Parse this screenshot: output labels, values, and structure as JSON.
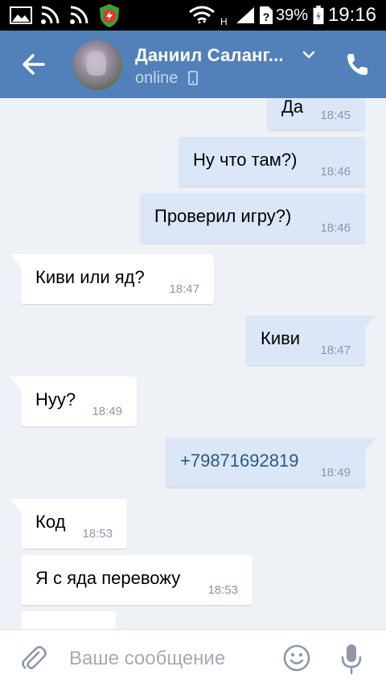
{
  "status_bar": {
    "network_indicator": "H",
    "battery_percent": "39%",
    "time": "19:16",
    "icons": [
      "image-icon",
      "rss-icon",
      "wifi-icon",
      "shield-app-icon",
      "wifi-signal-icon",
      "cell-signal-icon",
      "unknown-sim-icon",
      "battery-charging-icon"
    ]
  },
  "header": {
    "contact_name": "Даниил Саланг...",
    "status": "online"
  },
  "messages": [
    {
      "direction": "out",
      "text": "Да",
      "time": "18:45"
    },
    {
      "direction": "out",
      "text": "Ну что там?)",
      "time": "18:46"
    },
    {
      "direction": "out",
      "text": "Проверил игру?)",
      "time": "18:46"
    },
    {
      "direction": "in",
      "text": "Киви или яд?",
      "time": "18:47"
    },
    {
      "direction": "out",
      "text": "Киви",
      "time": "18:47"
    },
    {
      "direction": "in",
      "text": "Нуу?",
      "time": "18:49"
    },
    {
      "direction": "out",
      "text": "+79871692819",
      "time": "18:49"
    },
    {
      "direction": "in",
      "text": "Код",
      "time": "18:53"
    },
    {
      "direction": "in",
      "text": "Я с яда перевожу",
      "time": "18:53"
    }
  ],
  "input": {
    "placeholder": "Ваше сообщение"
  },
  "colors": {
    "header_bg": "#5181b8",
    "chat_bg": "#eef1f5",
    "outgoing_bubble": "#dbe7f6",
    "incoming_bubble": "#ffffff",
    "link": "#2a5885",
    "timestamp": "#8a97a6"
  }
}
